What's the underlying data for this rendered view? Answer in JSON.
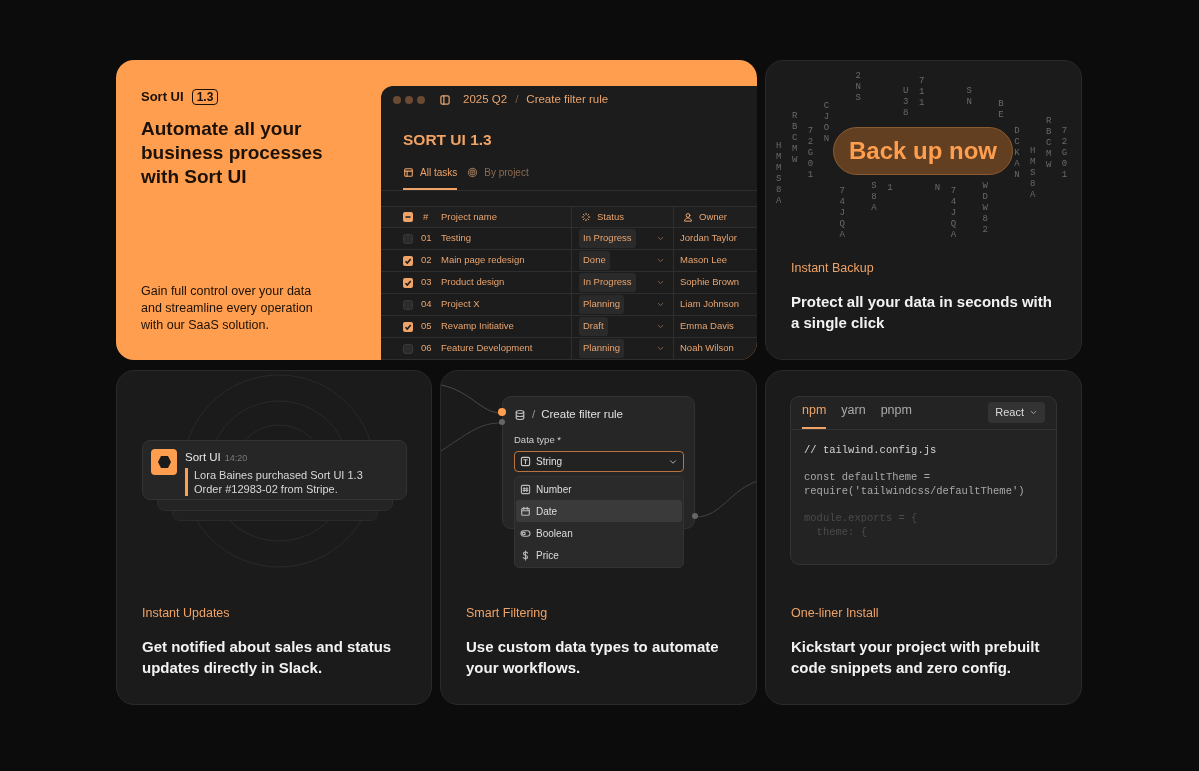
{
  "hero": {
    "brand": "Sort UI",
    "version": "1.3",
    "headline": "Automate all your business processes with Sort UI",
    "description": "Gain full control over your data and streamline every operation with our SaaS solution."
  },
  "app": {
    "breadcrumb": [
      "2025 Q2",
      "Create filter rule"
    ],
    "breadcrumb_separator": "/",
    "title": "SORT UI 1.3",
    "tabs": [
      {
        "label": "All tasks",
        "selected": true
      },
      {
        "label": "By project",
        "selected": false
      }
    ],
    "header_checkbox": {
      "indeterminate": true
    },
    "columns": [
      "#",
      "Project name",
      "Status",
      "Owner"
    ],
    "rows": [
      {
        "checked": false,
        "number": "01",
        "name": "Testing",
        "status": "In Progress",
        "owner": "Jordan Taylor"
      },
      {
        "checked": true,
        "number": "02",
        "name": "Main page redesign",
        "status": "Done",
        "owner": "Mason Lee"
      },
      {
        "checked": true,
        "number": "03",
        "name": "Product design",
        "status": "In Progress",
        "owner": "Sophie Brown"
      },
      {
        "checked": false,
        "number": "04",
        "name": "Project X",
        "status": "Planning",
        "owner": "Liam Johnson"
      },
      {
        "checked": true,
        "number": "05",
        "name": "Revamp Initiative",
        "status": "Draft",
        "owner": "Emma Davis"
      },
      {
        "checked": false,
        "number": "06",
        "name": "Feature Development",
        "status": "Planning",
        "owner": "Noah Wilson"
      }
    ]
  },
  "backup": {
    "rain": [
      "HMMS8A",
      "RBCMW",
      "72G01",
      "CJON",
      "74JQA",
      "2NS",
      "S8A",
      "1",
      "U38",
      "711",
      "N",
      "74JQA",
      "SN",
      "WDW82",
      "BE",
      "DCKAN",
      "HMS8A",
      "RBCMW",
      "72G01"
    ],
    "button": "Back up now",
    "label": "Instant Backup",
    "text": "Protect all your data in seconds with a single click"
  },
  "updates": {
    "notification": {
      "app": "Sort UI",
      "time": "14:20",
      "lines": [
        "Lora Baines purchased Sort UI 1.3",
        "Order #12983-02 from Stripe."
      ]
    },
    "label": "Instant Updates",
    "text": "Get notified about sales and status updates directly in Slack."
  },
  "filtering": {
    "separator": "/",
    "crumb": "Create filter rule",
    "field_label": "Data type *",
    "value": "String",
    "options": [
      {
        "kind": "number",
        "label": "Number",
        "selected": false
      },
      {
        "kind": "date",
        "label": "Date",
        "selected": true
      },
      {
        "kind": "boolean",
        "label": "Boolean",
        "selected": false
      },
      {
        "kind": "price",
        "label": "Price",
        "selected": false
      }
    ],
    "label": "Smart Filtering",
    "text": "Use custom data types to automate your workflows."
  },
  "install": {
    "tabs": [
      {
        "label": "npm",
        "selected": true
      },
      {
        "label": "yarn",
        "selected": false
      },
      {
        "label": "pnpm",
        "selected": false
      }
    ],
    "framework": "React",
    "code_blocks": [
      [
        "// tailwind.config.js"
      ],
      [
        "const defaultTheme =",
        "require('tailwindcss/defaultTheme')"
      ],
      [
        "module.exports = {",
        "  theme: {"
      ]
    ],
    "label": "One-liner Install",
    "text": "Kickstart your project with prebuilt code snippets and zero config."
  }
}
